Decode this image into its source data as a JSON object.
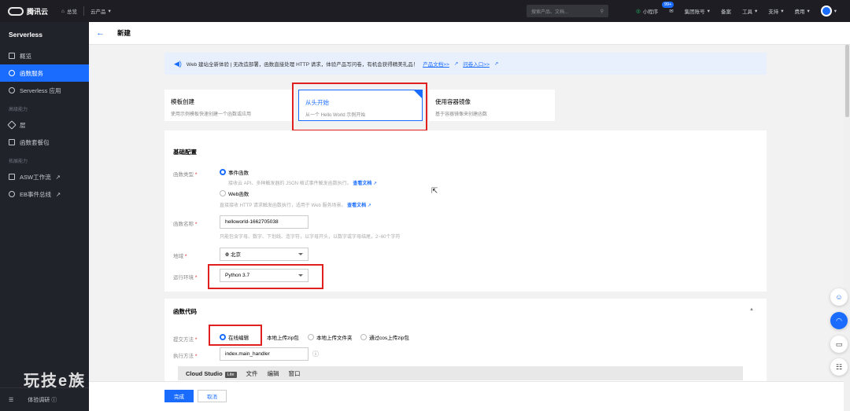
{
  "topbar": {
    "brand": "腾讯云",
    "home": "总览",
    "products": "云产品",
    "search_placeholder": "搜索产品、文档...",
    "mini_program": "小程序",
    "mail_badge": "99+",
    "account": "集团账号",
    "filing": "备案",
    "tools": "工具",
    "support": "支持",
    "billing": "费用"
  },
  "sidebar": {
    "title": "Serverless",
    "items": [
      {
        "label": "概览"
      },
      {
        "label": "函数服务"
      },
      {
        "label": "Serverless 应用"
      }
    ],
    "group_advanced": "高级能力",
    "advanced_items": [
      {
        "label": "层"
      },
      {
        "label": "函数套餐包"
      }
    ],
    "group_extend": "拓展能力",
    "extend_items": [
      {
        "label": "ASW工作流"
      },
      {
        "label": "EB事件总线"
      }
    ],
    "footer_label": "体验调研",
    "watermark": "玩技e族"
  },
  "page": {
    "title": "新建"
  },
  "notice": {
    "text": "Web 建站全新体验 | 无改造部署，函数直接处理 HTTP 请求，体验产品写问卷，有机会获得精美礼品！",
    "link_docs": "产品文档>>",
    "link_survey": "问卷入口>>"
  },
  "cards": [
    {
      "title": "模板创建",
      "subtitle": "使用示例模板快速创建一个函数或应用"
    },
    {
      "title": "从头开始",
      "subtitle": "从一个 Hello World 示例开始"
    },
    {
      "title": "使用容器镜像",
      "subtitle": "基于容器镜像来创建函数"
    }
  ],
  "basic": {
    "title": "基础配置",
    "func_type_label": "函数类型",
    "event_func": "事件函数",
    "event_hint": "接收云 API、多种触发器的 JSON 格式事件触发函数执行。",
    "web_func": "Web函数",
    "web_hint": "直接接收 HTTP 请求触发函数执行，适用于 Web 服务场景。",
    "view_docs": "查看文档",
    "name_label": "函数名称",
    "name_value": "helloworld-1662705038",
    "name_hint": "只能包含字母、数字、下划线、连字符，以字母开头，以数字或字母结尾，2~60个字符",
    "region_label": "地域",
    "region_value": "北京",
    "runtime_label": "运行环境",
    "runtime_value": "Python 3.7"
  },
  "code": {
    "title": "函数代码",
    "submit_label": "提交方法",
    "online_edit": "在线编辑",
    "local_zip": "本地上传zip包",
    "local_folder": "本地上传文件夹",
    "cos_zip": "通过cos上传zip包",
    "handler_label": "执行方法",
    "handler_value": "index.main_handler",
    "studio_brand": "Cloud Studio",
    "studio_tag": "Lite",
    "menu_file": "文件",
    "menu_edit": "编辑",
    "menu_window": "窗口"
  },
  "footer": {
    "confirm": "完成",
    "cancel": "取消"
  },
  "colors": {
    "accent": "#1a6cff",
    "highlight": "#e0201e",
    "sidebar": "#21232a"
  }
}
